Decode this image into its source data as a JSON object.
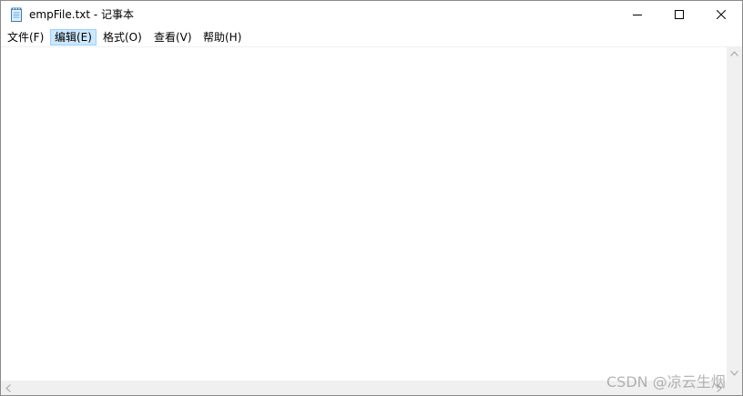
{
  "window": {
    "title": "empFile.txt - 记事本"
  },
  "icons": {
    "app": "notepad-icon",
    "minimize": "minimize-icon",
    "maximize": "maximize-icon",
    "close": "close-icon"
  },
  "menu": {
    "items": [
      "文件(F)",
      "编辑(E)",
      "格式(O)",
      "查看(V)",
      "帮助(H)"
    ],
    "highlighted": "编辑(E)"
  },
  "editor": {
    "content": ""
  },
  "watermark": "CSDN @凉云生烟",
  "colors": {
    "menu_highlight": "#cce8ff",
    "scrollbar": "#f0f0f0"
  }
}
